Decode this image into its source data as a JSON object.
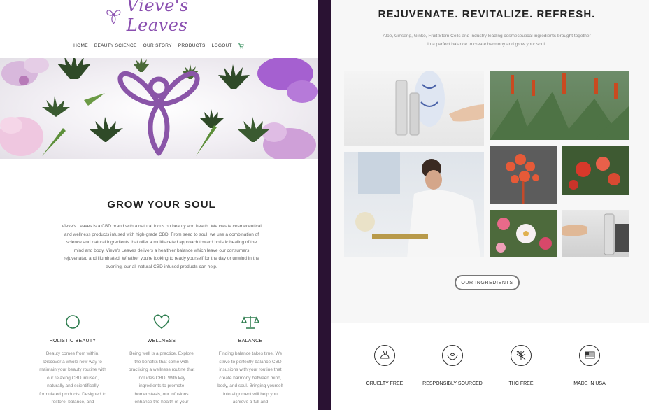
{
  "brand": {
    "name": "Vieve's Leaves"
  },
  "nav": {
    "items": [
      "HOME",
      "BEAUTY SCIENCE",
      "OUR STORY",
      "PRODUCTS",
      "LOGOUT"
    ],
    "cart_icon": "cart-icon"
  },
  "grow": {
    "title": "GROW YOUR SOUL",
    "text": "Vieve's Leaves is a CBD brand with a natural focus on beauty and health. We create cosmeceutical and wellness products infused with high-grade CBD. From seed to soul, we use a combination of science and natural ingredients that offer a multifaceted approach toward holistic healing of the mind and body. Vieve's Leaves delivers a healthier balance which leave our consumers rejuvenated and illuminated. Whether you're looking to ready yourself for the day or unwind in the evening, our all-natural CBD-infused products can help."
  },
  "features": [
    {
      "title": "HOLISTIC BEAUTY",
      "icon": "circle-icon",
      "text": "Beauty comes from within. Discover a whole new way to maintain your beauty routine with our relaxing CBD infused, naturally and scientifically formulated products. Designed to restore, balance, and"
    },
    {
      "title": "WELLNESS",
      "icon": "heart-icon",
      "text": "Being well is a practice. Explore the benefits that come with practicing a wellness routine that includes CBD. With key ingredients to promote homeostasis, our infusions enhance the health of your"
    },
    {
      "title": "BALANCE",
      "icon": "scale-icon",
      "text": "Finding balance takes time. We strive to perfectly balance CBD insusions with your routine that create harmony between mind, body, and soul. Bringing yourself into alignment will help you achieve a full and"
    }
  ],
  "right": {
    "title": "REJUVENATE. REVITALIZE. REFRESH.",
    "subtitle": "Aloe, Ginseng, Ginko, Fruit Stem Cells and industry leading cosmeceutical ingredients brought together in a perfect balance to create harmony and grow your soul.",
    "button_label": "OUR INGREDIENTS"
  },
  "badges": [
    {
      "label": "CRUELTY FREE",
      "icon": "bunny-icon"
    },
    {
      "label": "RESPONSIBLY SOURCED",
      "icon": "hands-icon"
    },
    {
      "label": "THC FREE",
      "icon": "leaf-icon"
    },
    {
      "label": "MADE IN USA",
      "icon": "flag-icon"
    }
  ],
  "colors": {
    "accent_purple": "#8a4fb0",
    "accent_green": "#2e7d4f",
    "divider": "#2a1233"
  }
}
